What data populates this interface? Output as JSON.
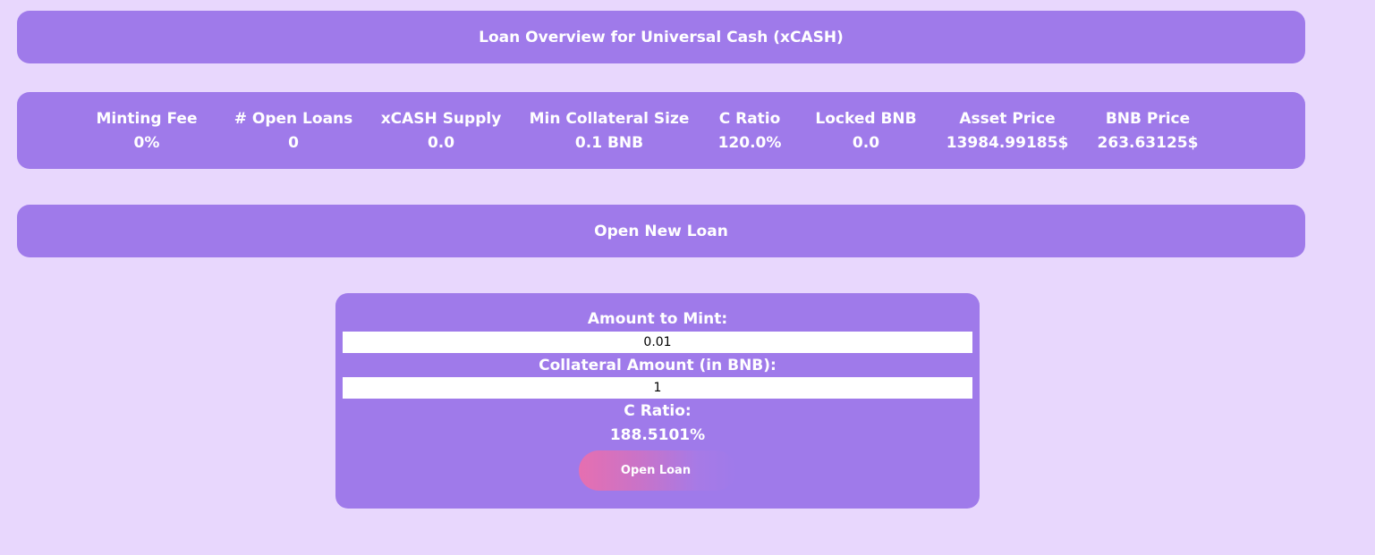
{
  "header": {
    "title": "Loan Overview for Universal Cash (xCASH)"
  },
  "stats": [
    {
      "label": "Minting Fee",
      "value": "0%"
    },
    {
      "label": "# Open Loans",
      "value": "0"
    },
    {
      "label": "xCASH Supply",
      "value": "0.0"
    },
    {
      "label": "Min Collateral Size",
      "value": "0.1 BNB"
    },
    {
      "label": "C Ratio",
      "value": "120.0%"
    },
    {
      "label": "Locked BNB",
      "value": "0.0"
    },
    {
      "label": "Asset Price",
      "value": "13984.99185$"
    },
    {
      "label": "BNB Price",
      "value": "263.63125$"
    }
  ],
  "open_loan_section": {
    "title": "Open New Loan"
  },
  "form": {
    "mint_label": "Amount to Mint:",
    "mint_value": "0.01",
    "collateral_label": "Collateral Amount (in BNB):",
    "collateral_value": "1",
    "ratio_label": "C Ratio:",
    "ratio_value": "188.5101%",
    "submit_label": "Open Loan"
  },
  "colors": {
    "background": "#e8d7fd",
    "panel": "#9f7aea",
    "button_gradient_start": "#e66fb0"
  }
}
